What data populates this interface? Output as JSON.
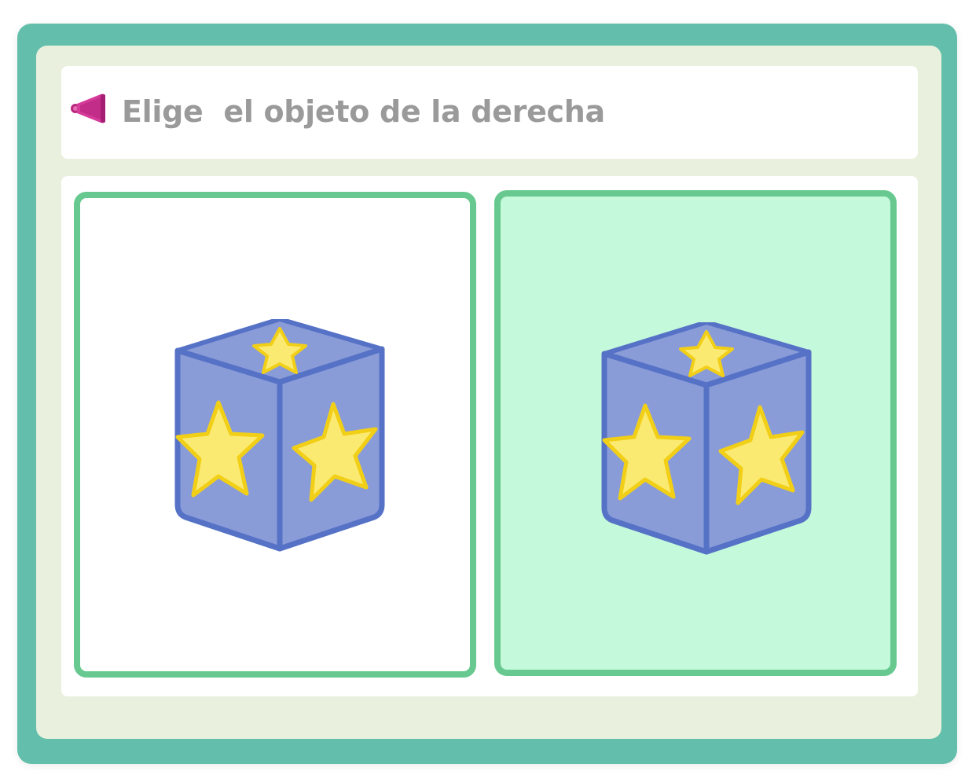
{
  "prompt": {
    "text": "Elige  el objeto de la derecha",
    "speaker_icon": "speaker-icon",
    "speaker_color": "#d63b9a"
  },
  "options": [
    {
      "object": "star-cube-icon",
      "selected": false
    },
    {
      "object": "star-cube-icon",
      "selected": true
    }
  ],
  "colors": {
    "frame": "#63bfab",
    "inner_background": "#e9f1de",
    "card_border": "#67c98f",
    "selected_card_background": "#c4f9dc",
    "cube_face": "#8a9cd8",
    "cube_edge": "#5672c6",
    "star_fill": "#fbea72",
    "star_edge": "#f2cf17",
    "prompt_text": "#9a9a9a"
  }
}
